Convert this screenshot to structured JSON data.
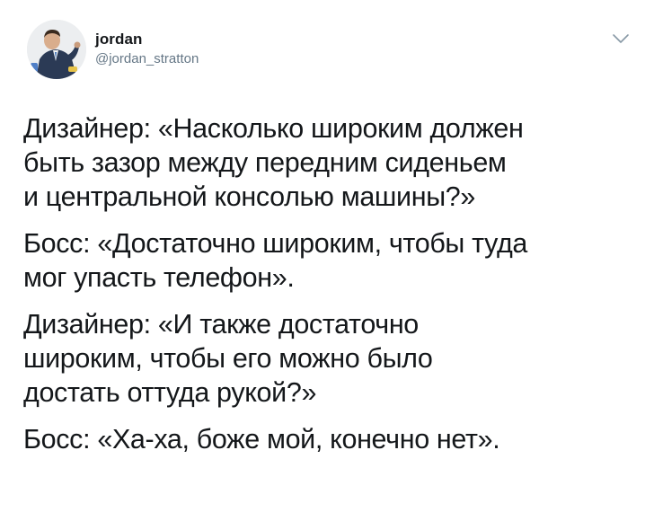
{
  "user": {
    "display_name": "jordan",
    "handle": "@jordan_stratton"
  },
  "icons": {
    "menu": "chevron-down-icon",
    "avatar": "profile-photo"
  },
  "tweet": {
    "paragraphs": [
      {
        "lines": [
          "Дизайнер: «Насколько широким должен",
          "быть зазор между передним сиденьем",
          "и центральной консолью машины?»"
        ]
      },
      {
        "lines": [
          "Босс: «Достаточно широким, чтобы туда",
          "мог упасть телефон»."
        ]
      },
      {
        "lines": [
          "Дизайнер: «И также достаточно",
          "широким, чтобы его можно было",
          "достать оттуда рукой?»"
        ]
      },
      {
        "lines": [
          "Босс: «Ха-ха, боже мой, конечно нет»."
        ]
      }
    ]
  },
  "colors": {
    "text": "#14171a",
    "secondary": "#657786",
    "background": "#ffffff"
  }
}
